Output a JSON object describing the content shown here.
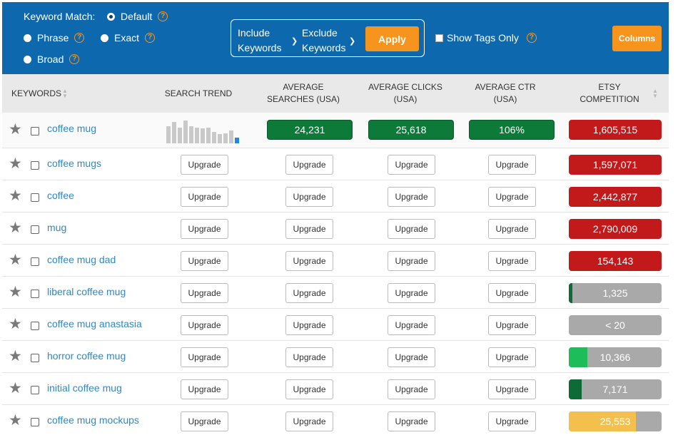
{
  "filters": {
    "keyword_match_label": "Keyword Match:",
    "match_options": [
      {
        "label": "Default",
        "checked": true
      },
      {
        "label": "Phrase",
        "checked": false
      },
      {
        "label": "Exact",
        "checked": false
      },
      {
        "label": "Broad",
        "checked": false
      }
    ],
    "include_line1": "Include",
    "include_line2": "Keywords",
    "exclude_line1": "Exclude",
    "exclude_line2": "Keywords",
    "apply_label": "Apply",
    "show_tags_only_label": "Show Tags Only",
    "columns_label": "Columns",
    "help_glyph": "?"
  },
  "table": {
    "headers": {
      "keywords": "KEYWORDS",
      "search_trend": "SEARCH TREND",
      "avg_searches": "AVERAGE SEARCHES (USA)",
      "avg_clicks": "AVERAGE CLICKS (USA)",
      "avg_ctr": "AVERAGE CTR (USA)",
      "competition": "ETSY COMPETITION"
    },
    "upgrade_label": "Upgrade",
    "first_row_metrics": {
      "searches": "24,231",
      "clicks": "25,618",
      "ctr": "106%"
    },
    "rows": [
      {
        "keyword": "coffee mug",
        "competition": "1,605,515",
        "comp_color": "#c21a1a",
        "comp_level": 1.0
      },
      {
        "keyword": "coffee mugs",
        "competition": "1,597,071",
        "comp_color": "#c21a1a",
        "comp_level": 1.0
      },
      {
        "keyword": "coffee",
        "competition": "2,442,877",
        "comp_color": "#c21a1a",
        "comp_level": 1.0
      },
      {
        "keyword": "mug",
        "competition": "2,790,009",
        "comp_color": "#c21a1a",
        "comp_level": 1.0
      },
      {
        "keyword": "coffee mug dad",
        "competition": "154,143",
        "comp_color": "#c21a1a",
        "comp_level": 1.0
      },
      {
        "keyword": "liberal coffee mug",
        "competition": "1,325",
        "comp_color": "#0e6b35",
        "comp_level": 0.04
      },
      {
        "keyword": "coffee mug anastasia",
        "competition": "< 20",
        "comp_color": "#0e6b35",
        "comp_level": 0.0
      },
      {
        "keyword": "horror coffee mug",
        "competition": "10,366",
        "comp_color": "#1dbd5a",
        "comp_level": 0.2
      },
      {
        "keyword": "initial coffee mug",
        "competition": "7,171",
        "comp_color": "#0e6b35",
        "comp_level": 0.14
      },
      {
        "keyword": "coffee mug mockups",
        "competition": "25,553",
        "comp_color": "#f4c04d",
        "comp_level": 0.72
      }
    ],
    "trend": [
      0.75,
      0.95,
      0.7,
      1.0,
      0.75,
      0.7,
      0.65,
      0.68,
      0.5,
      0.4,
      0.45,
      0.55,
      0.3
    ]
  }
}
